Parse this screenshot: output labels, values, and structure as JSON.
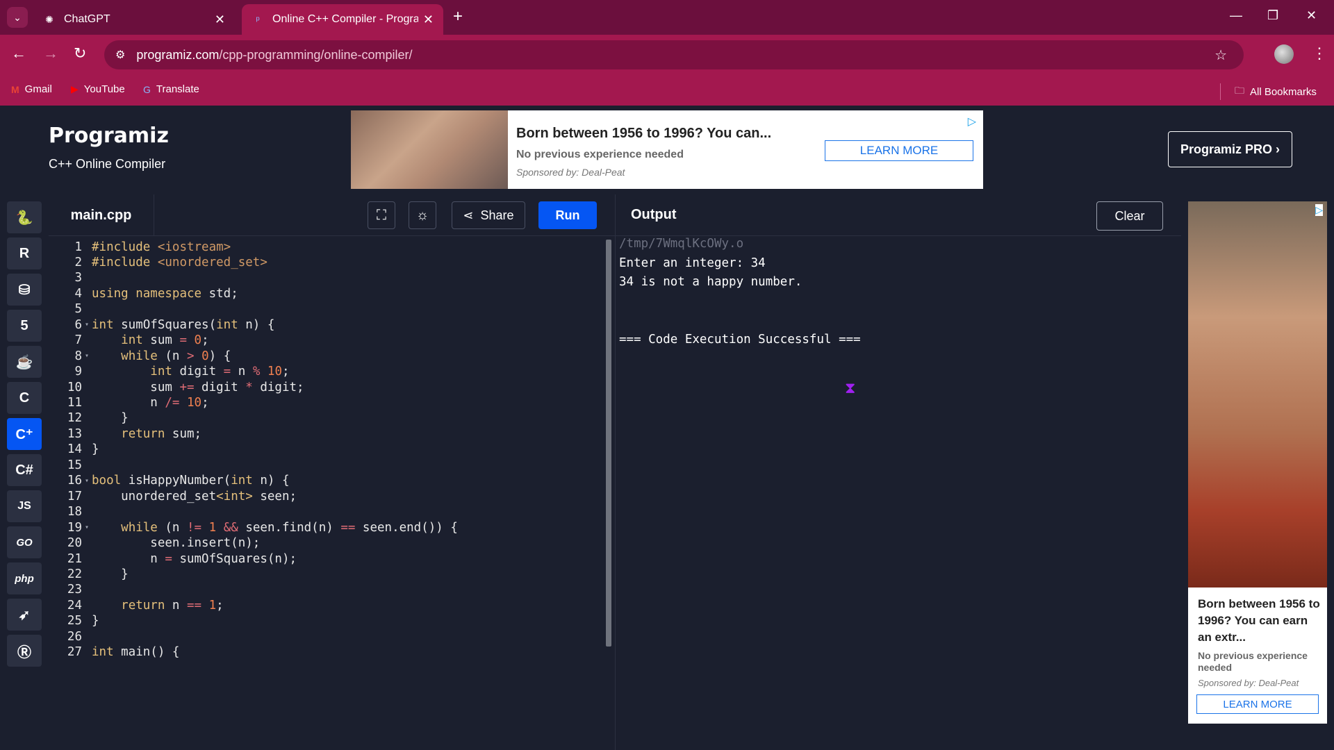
{
  "browser": {
    "tabs": [
      {
        "title": "ChatGPT",
        "active": false
      },
      {
        "title": "Online C++ Compiler - Program",
        "active": true
      }
    ],
    "url_host": "programiz.com",
    "url_path": "/cpp-programming/online-compiler/",
    "bookmarks": [
      "Gmail",
      "YouTube",
      "Translate"
    ],
    "all_bookmarks": "All Bookmarks",
    "accent_color": "#a3184f"
  },
  "site": {
    "logo": "Programiz",
    "subtitle": "C++ Online Compiler",
    "pro_button": "Programiz PRO ›"
  },
  "banner_ad": {
    "title": "Born between 1956 to 1996? You can...",
    "subtitle": "No previous experience needed",
    "sponsor": "Sponsored by: Deal-Peat",
    "cta": "LEARN MORE"
  },
  "rail": [
    "python-icon",
    "r-icon",
    "sql-icon",
    "html5-icon",
    "java-icon",
    "c-icon",
    "cpp-icon",
    "csharp-icon",
    "JS",
    "GO",
    "php",
    "swift-icon",
    "rust-icon"
  ],
  "editor": {
    "file_name": "main.cpp",
    "share_label": "Share",
    "run_label": "Run",
    "lines": [
      "#include <iostream>",
      "#include <unordered_set>",
      "",
      "using namespace std;",
      "",
      "int sumOfSquares(int n) {",
      "    int sum = 0;",
      "    while (n > 0) {",
      "        int digit = n % 10;",
      "        sum += digit * digit;",
      "        n /= 10;",
      "    }",
      "    return sum;",
      "}",
      "",
      "bool isHappyNumber(int n) {",
      "    unordered_set<int> seen;",
      "",
      "    while (n != 1 && seen.find(n) == seen.end()) {",
      "        seen.insert(n);",
      "        n = sumOfSquares(n);",
      "    }",
      "",
      "    return n == 1;",
      "}",
      "",
      "int main() {"
    ]
  },
  "output": {
    "title": "Output",
    "clear_label": "Clear",
    "lines": [
      "/tmp/7WmqlKcOWy.o",
      "Enter an integer: 34",
      "34 is not a happy number.",
      "",
      "",
      "=== Code Execution Successful ==="
    ]
  },
  "side_ad": {
    "title": "Born between 1956 to 1996? You can earn an extr...",
    "subtitle": "No previous experience needed",
    "sponsor": "Sponsored by: Deal-Peat",
    "cta": "LEARN MORE"
  }
}
